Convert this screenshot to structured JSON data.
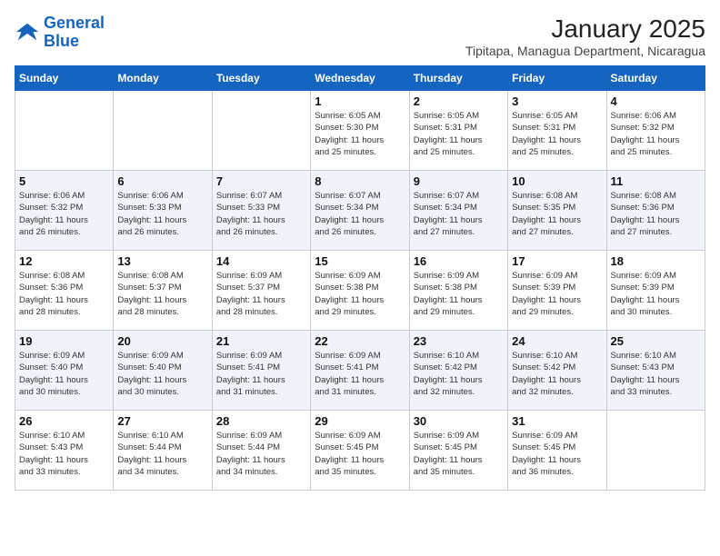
{
  "header": {
    "logo_general": "General",
    "logo_blue": "Blue",
    "title": "January 2025",
    "subtitle": "Tipitapa, Managua Department, Nicaragua"
  },
  "days_of_week": [
    "Sunday",
    "Monday",
    "Tuesday",
    "Wednesday",
    "Thursday",
    "Friday",
    "Saturday"
  ],
  "weeks": [
    [
      {
        "day": "",
        "info": ""
      },
      {
        "day": "",
        "info": ""
      },
      {
        "day": "",
        "info": ""
      },
      {
        "day": "1",
        "info": "Sunrise: 6:05 AM\nSunset: 5:30 PM\nDaylight: 11 hours\nand 25 minutes."
      },
      {
        "day": "2",
        "info": "Sunrise: 6:05 AM\nSunset: 5:31 PM\nDaylight: 11 hours\nand 25 minutes."
      },
      {
        "day": "3",
        "info": "Sunrise: 6:05 AM\nSunset: 5:31 PM\nDaylight: 11 hours\nand 25 minutes."
      },
      {
        "day": "4",
        "info": "Sunrise: 6:06 AM\nSunset: 5:32 PM\nDaylight: 11 hours\nand 25 minutes."
      }
    ],
    [
      {
        "day": "5",
        "info": "Sunrise: 6:06 AM\nSunset: 5:32 PM\nDaylight: 11 hours\nand 26 minutes."
      },
      {
        "day": "6",
        "info": "Sunrise: 6:06 AM\nSunset: 5:33 PM\nDaylight: 11 hours\nand 26 minutes."
      },
      {
        "day": "7",
        "info": "Sunrise: 6:07 AM\nSunset: 5:33 PM\nDaylight: 11 hours\nand 26 minutes."
      },
      {
        "day": "8",
        "info": "Sunrise: 6:07 AM\nSunset: 5:34 PM\nDaylight: 11 hours\nand 26 minutes."
      },
      {
        "day": "9",
        "info": "Sunrise: 6:07 AM\nSunset: 5:34 PM\nDaylight: 11 hours\nand 27 minutes."
      },
      {
        "day": "10",
        "info": "Sunrise: 6:08 AM\nSunset: 5:35 PM\nDaylight: 11 hours\nand 27 minutes."
      },
      {
        "day": "11",
        "info": "Sunrise: 6:08 AM\nSunset: 5:36 PM\nDaylight: 11 hours\nand 27 minutes."
      }
    ],
    [
      {
        "day": "12",
        "info": "Sunrise: 6:08 AM\nSunset: 5:36 PM\nDaylight: 11 hours\nand 28 minutes."
      },
      {
        "day": "13",
        "info": "Sunrise: 6:08 AM\nSunset: 5:37 PM\nDaylight: 11 hours\nand 28 minutes."
      },
      {
        "day": "14",
        "info": "Sunrise: 6:09 AM\nSunset: 5:37 PM\nDaylight: 11 hours\nand 28 minutes."
      },
      {
        "day": "15",
        "info": "Sunrise: 6:09 AM\nSunset: 5:38 PM\nDaylight: 11 hours\nand 29 minutes."
      },
      {
        "day": "16",
        "info": "Sunrise: 6:09 AM\nSunset: 5:38 PM\nDaylight: 11 hours\nand 29 minutes."
      },
      {
        "day": "17",
        "info": "Sunrise: 6:09 AM\nSunset: 5:39 PM\nDaylight: 11 hours\nand 29 minutes."
      },
      {
        "day": "18",
        "info": "Sunrise: 6:09 AM\nSunset: 5:39 PM\nDaylight: 11 hours\nand 30 minutes."
      }
    ],
    [
      {
        "day": "19",
        "info": "Sunrise: 6:09 AM\nSunset: 5:40 PM\nDaylight: 11 hours\nand 30 minutes."
      },
      {
        "day": "20",
        "info": "Sunrise: 6:09 AM\nSunset: 5:40 PM\nDaylight: 11 hours\nand 30 minutes."
      },
      {
        "day": "21",
        "info": "Sunrise: 6:09 AM\nSunset: 5:41 PM\nDaylight: 11 hours\nand 31 minutes."
      },
      {
        "day": "22",
        "info": "Sunrise: 6:09 AM\nSunset: 5:41 PM\nDaylight: 11 hours\nand 31 minutes."
      },
      {
        "day": "23",
        "info": "Sunrise: 6:10 AM\nSunset: 5:42 PM\nDaylight: 11 hours\nand 32 minutes."
      },
      {
        "day": "24",
        "info": "Sunrise: 6:10 AM\nSunset: 5:42 PM\nDaylight: 11 hours\nand 32 minutes."
      },
      {
        "day": "25",
        "info": "Sunrise: 6:10 AM\nSunset: 5:43 PM\nDaylight: 11 hours\nand 33 minutes."
      }
    ],
    [
      {
        "day": "26",
        "info": "Sunrise: 6:10 AM\nSunset: 5:43 PM\nDaylight: 11 hours\nand 33 minutes."
      },
      {
        "day": "27",
        "info": "Sunrise: 6:10 AM\nSunset: 5:44 PM\nDaylight: 11 hours\nand 34 minutes."
      },
      {
        "day": "28",
        "info": "Sunrise: 6:09 AM\nSunset: 5:44 PM\nDaylight: 11 hours\nand 34 minutes."
      },
      {
        "day": "29",
        "info": "Sunrise: 6:09 AM\nSunset: 5:45 PM\nDaylight: 11 hours\nand 35 minutes."
      },
      {
        "day": "30",
        "info": "Sunrise: 6:09 AM\nSunset: 5:45 PM\nDaylight: 11 hours\nand 35 minutes."
      },
      {
        "day": "31",
        "info": "Sunrise: 6:09 AM\nSunset: 5:45 PM\nDaylight: 11 hours\nand 36 minutes."
      },
      {
        "day": "",
        "info": ""
      }
    ]
  ]
}
